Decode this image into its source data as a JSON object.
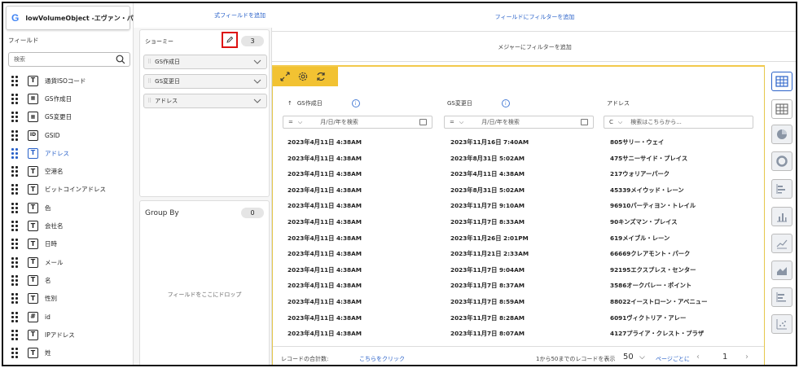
{
  "object_header": {
    "logo": "G",
    "title": "lowVolumeObject -エヴァン・パーソン"
  },
  "fields_panel": {
    "label": "フィールド",
    "search_placeholder": "検索",
    "fields": [
      {
        "icon": "T",
        "name": "通貨ISOコード",
        "selected": false
      },
      {
        "icon": "cal",
        "name": "GS作成日",
        "selected": false
      },
      {
        "icon": "cal",
        "name": "GS変更日",
        "selected": false
      },
      {
        "icon": "ID",
        "name": "GSID",
        "selected": false
      },
      {
        "icon": "T",
        "name": "アドレス",
        "selected": true
      },
      {
        "icon": "T",
        "name": "空港名",
        "selected": false
      },
      {
        "icon": "T",
        "name": "ビットコインアドレス",
        "selected": false
      },
      {
        "icon": "T",
        "name": "色",
        "selected": false
      },
      {
        "icon": "T",
        "name": "会社名",
        "selected": false
      },
      {
        "icon": "T",
        "name": "日時",
        "selected": false
      },
      {
        "icon": "T",
        "name": "メール",
        "selected": false
      },
      {
        "icon": "T",
        "name": "名",
        "selected": false
      },
      {
        "icon": "T",
        "name": "性別",
        "selected": false
      },
      {
        "icon": "#",
        "name": "id",
        "selected": false
      },
      {
        "icon": "T",
        "name": "IPアドレス",
        "selected": false
      },
      {
        "icon": "T",
        "name": "姓",
        "selected": false
      }
    ]
  },
  "middle_panel": {
    "add_formula_label": "式フィールドを追加",
    "show": {
      "title": "ショーミー",
      "count": "3",
      "items": [
        "GS作成日",
        "GS変更日",
        "アドレス"
      ]
    },
    "group_by": {
      "title": "Group By",
      "count": "0",
      "drop_text": "フィールドをここにドロップ"
    }
  },
  "main": {
    "add_filter_label": "フィールドにフィルターを追加",
    "measure_filter_label": "メジャーにフィルターを追加",
    "columns": [
      {
        "title": "GS作成日",
        "sort_icon": "↑",
        "filter_op": "=",
        "filter_placeholder": "月/日/年を検索"
      },
      {
        "title": "GS変更日",
        "sort_icon": "",
        "filter_op": "=",
        "filter_placeholder": "月/日/年を検索"
      },
      {
        "title": "アドレス",
        "sort_icon": "",
        "filter_op": "C",
        "filter_placeholder": "検索はこちらから..."
      }
    ],
    "rows": [
      [
        "2023年4月11日 4:38AM",
        "2023年11月16日 7:40AM",
        "805サリー・ウェイ"
      ],
      [
        "2023年4月11日 4:38AM",
        "2023年8月31日 5:02AM",
        "475サニーサイド・プレイス"
      ],
      [
        "2023年4月11日 4:38AM",
        "2023年4月11日 4:38AM",
        "217ウォリアーパーク"
      ],
      [
        "2023年4月11日 4:38AM",
        "2023年8月31日 5:02AM",
        "45339メイウッド・レーン"
      ],
      [
        "2023年4月11日 4:38AM",
        "2023年11月7日 9:10AM",
        "96910パーティヨン・トレイル"
      ],
      [
        "2023年4月11日 4:38AM",
        "2023年11月7日 8:33AM",
        "90キンズマン・プレイス"
      ],
      [
        "2023年4月11日 4:38AM",
        "2023年11月26日 2:01PM",
        "619メイブル・レーン"
      ],
      [
        "2023年4月11日 4:38AM",
        "2023年11月21日 2:33AM",
        "66669クレアモント・パーク"
      ],
      [
        "2023年4月11日 4:38AM",
        "2023年11月7日 9:04AM",
        "92195エクスプレス・センター"
      ],
      [
        "2023年4月11日 4:38AM",
        "2023年11月7日 8:37AM",
        "3586オークバレー・ポイント"
      ],
      [
        "2023年4月11日 4:38AM",
        "2023年11月7日 8:59AM",
        "88022イーストローン・アベニュー"
      ],
      [
        "2023年4月11日 4:38AM",
        "2023年11月7日 8:28AM",
        "6091ヴィクトリア・アレー"
      ],
      [
        "2023年4月11日 4:38AM",
        "2023年11月7日 8:07AM",
        "4127プライア・クレスト・プラザ"
      ]
    ],
    "footer": {
      "total_label": "レコードの合計数:",
      "click_link": "こちらをクリック",
      "range_text": "1から50までのレコードを表示",
      "page_size": "50",
      "per_page_label": "ページごとに",
      "prev": "‹",
      "page": "1",
      "next": "›"
    }
  },
  "viz_icons": [
    "table-icon",
    "pivot-table-icon",
    "pie-chart-icon",
    "donut-chart-icon",
    "bar-chart-icon",
    "column-chart-icon",
    "line-chart-icon",
    "area-chart-icon",
    "stacked-bar-icon",
    "scatter-icon"
  ],
  "colors": {
    "accent_blue": "#2a62c9",
    "toolbar_yellow": "#f2c232",
    "highlight_red": "#dd1111"
  }
}
